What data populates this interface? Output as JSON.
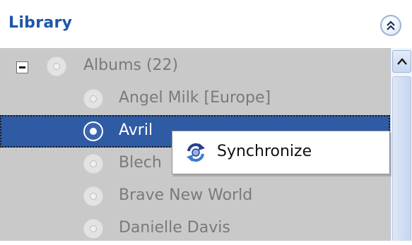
{
  "header": {
    "title": "Library",
    "collapse_icon": "double-chevron-up-icon"
  },
  "tree": {
    "root": {
      "label": "Albums (22)",
      "expanded": true
    },
    "items": [
      {
        "label": "Angel Milk [Europe]"
      },
      {
        "label": "Avril",
        "selected": true
      },
      {
        "label": "Blech"
      },
      {
        "label": "Brave New World"
      },
      {
        "label": "Danielle Davis"
      }
    ]
  },
  "context_menu": {
    "items": [
      {
        "label": "Synchronize",
        "icon": "synchronize-icon"
      }
    ]
  },
  "colors": {
    "title": "#1f55a8",
    "selection": "#2f5ba5",
    "tree_background": "#c9c9c9"
  }
}
